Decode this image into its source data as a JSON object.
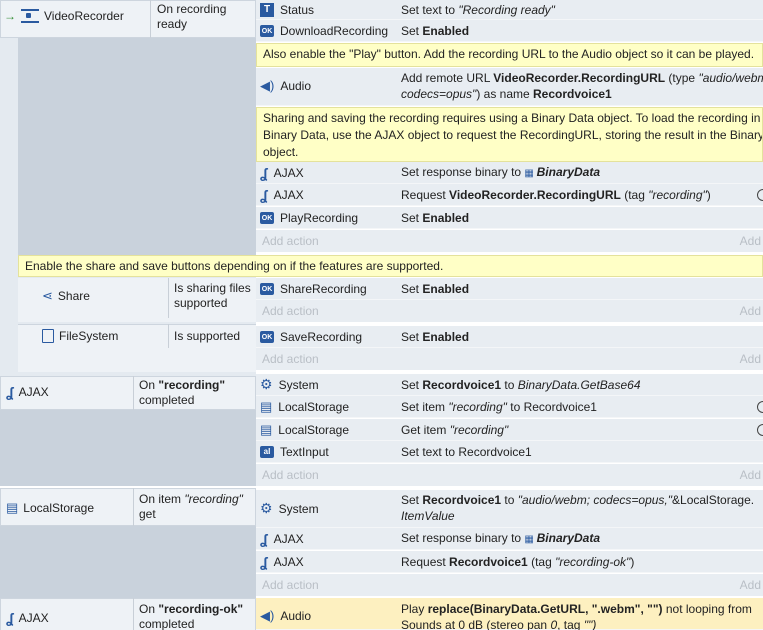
{
  "events": {
    "video_recorder": {
      "object": "VideoRecorder",
      "condition": "On recording ready",
      "actions": [
        {
          "object": "Status",
          "text_pre": "Set text to ",
          "text_it": "\"Recording ready\""
        },
        {
          "object": "DownloadRecording",
          "text_pre": "Set ",
          "text_b": "Enabled"
        }
      ],
      "comment1": "Also enable the \"Play\" button. Add the recording URL to the Audio object so it can be played.",
      "audio": {
        "object": "Audio",
        "line1_pre": "Add remote URL ",
        "line1_b": "VideoRecorder.RecordingURL",
        "line1_post": " (type ",
        "line1_it": "\"audio/webm;",
        "line2_it": "codecs=opus\"",
        "line2_mid": ") as name ",
        "line2_b": "Recordvoice1"
      },
      "comment2": [
        "Sharing and saving the recording requires using a Binary Data object. To load the recording in to a",
        "Binary Data, use the AJAX object to request the RecordingURL, storing the result in the Binary Data",
        "object."
      ],
      "actions2": [
        {
          "object": "AJAX",
          "text_pre": "Set response binary to ",
          "text_bi": "BinaryData"
        },
        {
          "object": "AJAX",
          "text_pre": "Request ",
          "text_b": "VideoRecorder.RecordingURL",
          "text_post": " (tag ",
          "text_it": "\"recording\"",
          "text_end": ")"
        },
        {
          "object": "PlayRecording",
          "text_pre": "Set ",
          "text_b": "Enabled"
        }
      ]
    },
    "add_action": "Add action",
    "add_short": "Add",
    "comment3": "Enable the share and save buttons depending on if the features are supported.",
    "share": {
      "object": "Share",
      "condition": [
        "Is sharing files",
        "supported"
      ],
      "action_object": "ShareRecording",
      "action_pre": "Set ",
      "action_b": "Enabled"
    },
    "filesystem": {
      "object": "FileSystem",
      "condition": "Is supported",
      "action_object": "SaveRecording",
      "action_pre": "Set ",
      "action_b": "Enabled"
    },
    "ajax_recording": {
      "object": "AJAX",
      "cond_pre": "On ",
      "cond_b": "\"recording\"",
      "cond_line2": "completed",
      "actions": [
        {
          "object": "System",
          "text_pre": "Set ",
          "text_b": "Recordvoice1",
          "text_mid": " to ",
          "text_it": "BinaryData.GetBase64"
        },
        {
          "object": "LocalStorage",
          "text_pre": "Set item ",
          "text_it": "\"recording\"",
          "text_post": " to Recordvoice1"
        },
        {
          "object": "LocalStorage",
          "text_pre": "Get item ",
          "text_it": "\"recording\""
        },
        {
          "object": "TextInput",
          "text_pre": "Set text to Recordvoice1"
        }
      ]
    },
    "localstorage_get": {
      "object": "LocalStorage",
      "cond_pre": "On item ",
      "cond_it": "\"recording\"",
      "cond_line2": "get",
      "system_object": "System",
      "system_line1_pre": "Set ",
      "system_line1_b": "Recordvoice1",
      "system_line1_mid": " to ",
      "system_line1_it": "\"audio/webm; codecs=opus,\"",
      "system_line1_post": "&LocalStorage.",
      "system_line2_it": "ItemValue",
      "actions": [
        {
          "object": "AJAX",
          "text_pre": "Set response binary to ",
          "text_bi": "BinaryData"
        },
        {
          "object": "AJAX",
          "text_pre": "Request ",
          "text_b": "Recordvoice1",
          "text_post": " (tag ",
          "text_it": "\"recording-ok\"",
          "text_end": ")"
        }
      ]
    },
    "ajax_ok": {
      "object": "AJAX",
      "cond_pre": "On ",
      "cond_b": "\"recording-ok\"",
      "cond_line2": "completed",
      "action_object": "Audio",
      "line1_pre": "Play ",
      "line1_b": "replace(BinaryData.GetURL, \".webm\", \"\")",
      "line1_post": "  not looping from",
      "line2": "Sounds at 0 dB (stereo pan ",
      "line2_it": "0",
      "line2_post": ", tag ",
      "line2_end": "\"\")"
    }
  },
  "colors": {
    "comment_bg": "#ffffc6",
    "event_bg": "#e4eaf0",
    "condition_block": "#c9d2dc",
    "highlight_row": "#fdf0c0",
    "icon_blue": "#2a5aa0"
  }
}
